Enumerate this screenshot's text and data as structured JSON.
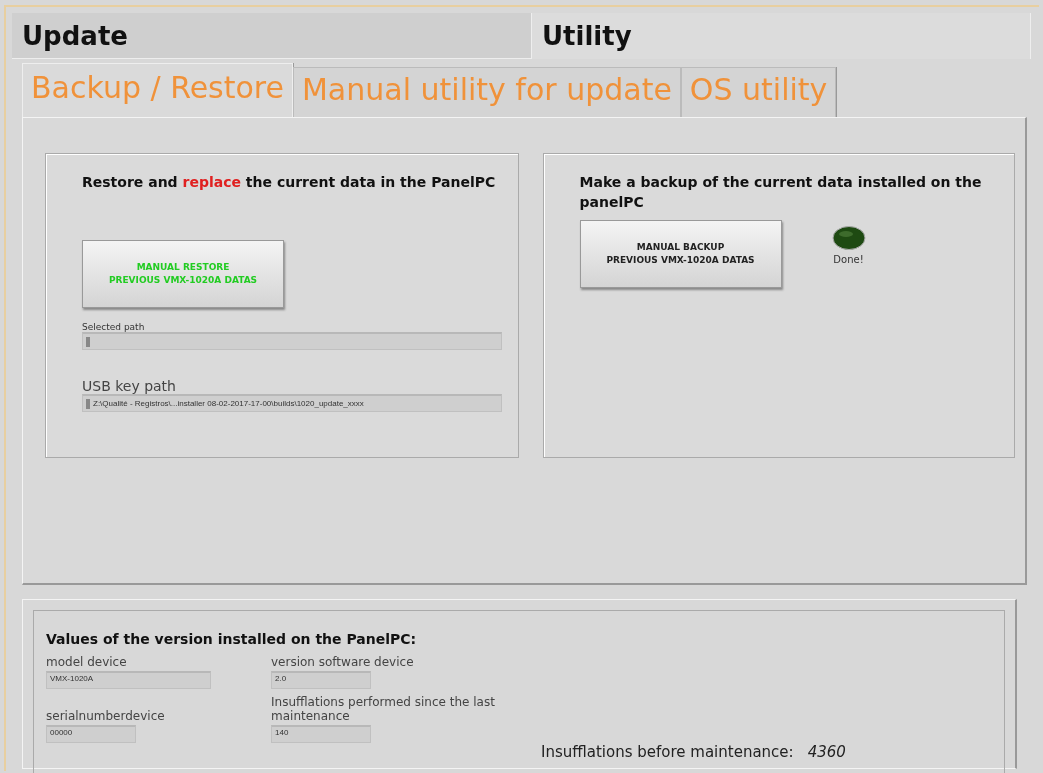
{
  "main_tabs": [
    {
      "label": "Update",
      "selected": false
    },
    {
      "label": "Utility",
      "selected": true
    }
  ],
  "sub_tabs": [
    {
      "label": "Backup / Restore",
      "selected": true
    },
    {
      "label": "Manual utility for update",
      "selected": false
    },
    {
      "label": "OS utility",
      "selected": false
    }
  ],
  "restore": {
    "heading_parts": [
      {
        "text": "Restore and ",
        "highlight": false
      },
      {
        "text": "replace",
        "highlight": true
      },
      {
        "text": " the current data in the PanelPC",
        "highlight": false
      }
    ],
    "button": [
      "MANUAL RESTORE",
      "PREVIOUS VMX-1020A DATAS"
    ],
    "selected_path": {
      "label": "Selected path"
    },
    "usb_path": {
      "label": "USB key path",
      "value": "Z:\\Qualité - Registros\\...installer 08-02-2017-17-00\\builds\\1020_update_xxxx"
    }
  },
  "backup": {
    "heading": "Make a backup of the current data installed on the panelPC",
    "button": [
      "MANUAL BACKUP",
      "PREVIOUS VMX-1020A DATAS"
    ],
    "led": {
      "label": "Done!",
      "on": false
    }
  },
  "version": {
    "heading": "Values of the version installed on the PanelPC:",
    "fields": [
      {
        "label": "model device",
        "value": "VMX-1020A"
      },
      {
        "label": "serialnumberdevice",
        "value": "00000"
      },
      {
        "label": "version software device",
        "value": "2.0"
      },
      {
        "label": "Insufflations performed since the last maintenance",
        "value": "140"
      }
    ],
    "before_label": "Insufflations before maintenance:",
    "before_value": "4360"
  }
}
